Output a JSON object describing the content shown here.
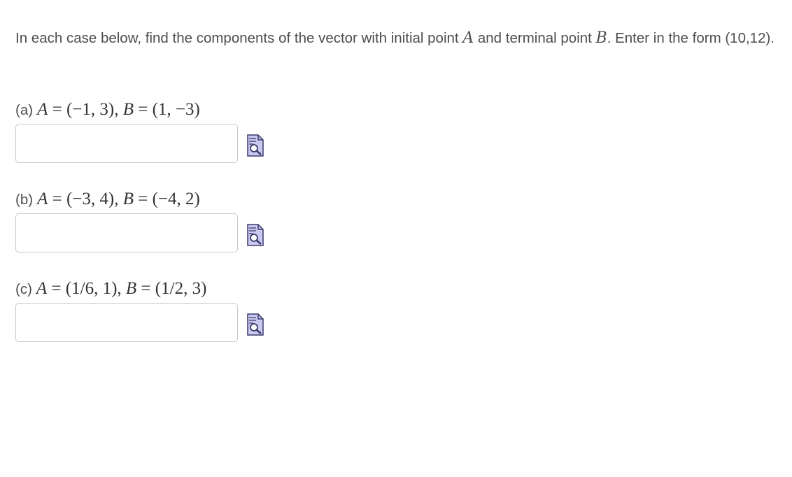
{
  "problem": {
    "intro_before_A": "In each case below, find the components of the vector with initial point ",
    "A": "A",
    "intro_between": " and terminal point ",
    "B": "B",
    "intro_after_B": ". Enter in the form (10,12)."
  },
  "parts": [
    {
      "label": "(a)",
      "A_value": "(−1, 3)",
      "B_value": "(1, −3)",
      "answer_value": "",
      "preview_icon": "preview-document-magnifier-icon"
    },
    {
      "label": "(b)",
      "A_value": "(−3, 4)",
      "B_value": "(−4, 2)",
      "answer_value": "",
      "preview_icon": "preview-document-magnifier-icon"
    },
    {
      "label": "(c)",
      "A_value": "(1/6, 1)",
      "B_value": "(1/2, 3)",
      "answer_value": "",
      "preview_icon": "preview-document-magnifier-icon"
    }
  ],
  "symbols": {
    "equals": "=",
    "comma": ", "
  },
  "colors": {
    "text": "#4d4d4d",
    "input_border": "#c9c9c9",
    "icon_fill": "#c8c8f0",
    "icon_stroke": "#3a3a6a"
  }
}
